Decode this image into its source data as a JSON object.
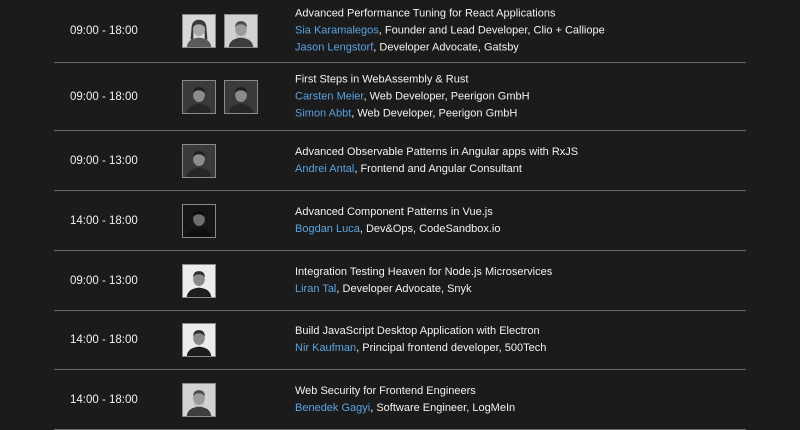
{
  "sessions": [
    {
      "time": "09:00 - 18:00",
      "title": "Advanced Performance Tuning for React Applications",
      "speakers": [
        {
          "name": "Sia Karamalegos",
          "role": ", Founder and Lead Developer, Clio + Calliope",
          "photo": "female-photo-light"
        },
        {
          "name": "Jason Lengstorf",
          "role": ", Developer Advocate, Gatsby",
          "photo": "male-bearded-photo-light"
        }
      ]
    },
    {
      "time": "09:00 - 18:00",
      "title": "First Steps in WebAssembly & Rust",
      "speakers": [
        {
          "name": "Carsten Meier",
          "role": ", Web Developer, Peerigon GmbH",
          "photo": "male-photo-dark"
        },
        {
          "name": "Simon Abbt",
          "role": ", Web Developer, Peerigon GmbH",
          "photo": "male-photo-dark"
        }
      ]
    },
    {
      "time": "09:00 - 13:00",
      "title": "Advanced Observable Patterns in Angular apps with RxJS",
      "speakers": [
        {
          "name": "Andrei Antal",
          "role": ", Frontend and Angular Consultant",
          "photo": "male-photo-dark"
        }
      ]
    },
    {
      "time": "14:00 - 18:00",
      "title": "Advanced Component Patterns in Vue.js",
      "speakers": [
        {
          "name": "Bogdan Luca",
          "role": ", Dev&Ops, CodeSandbox.io",
          "photo": "male-photo-black"
        }
      ]
    },
    {
      "time": "09:00 - 13:00",
      "title": "Integration Testing Heaven for Node.js Microservices",
      "speakers": [
        {
          "name": "Liran Tal",
          "role": ", Developer Advocate, Snyk",
          "photo": "male-photo-light"
        }
      ]
    },
    {
      "time": "14:00 - 18:00",
      "title": "Build JavaScript Desktop Application with Electron",
      "speakers": [
        {
          "name": "Nir Kaufman",
          "role": ", Principal frontend developer, 500Tech",
          "photo": "male-photo-light"
        }
      ]
    },
    {
      "time": "14:00 - 18:00",
      "title": "Web Security for Frontend Engineers",
      "speakers": [
        {
          "name": "Benedek Gagyi",
          "role": ", Software Engineer, LogMeIn",
          "photo": "male-bearded-photo-light"
        }
      ]
    }
  ]
}
